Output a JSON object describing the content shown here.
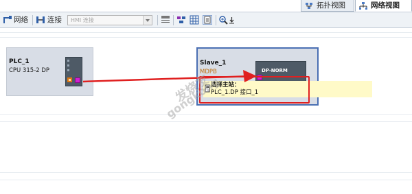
{
  "view_tabs": [
    {
      "label": "拓扑视图",
      "icon": "topology-view-icon",
      "active": false
    },
    {
      "label": "网络视图",
      "icon": "network-view-icon",
      "active": true
    }
  ],
  "toolbar": {
    "network_label": "网络",
    "connections_label": "连接",
    "connection_type_value": "HMI 连接"
  },
  "devices": [
    {
      "name": "PLC_1",
      "type": "CPU 315-2 DP"
    },
    {
      "name": "Slave_1",
      "type": "MDPB",
      "badge": "DP-NORM"
    }
  ],
  "tooltip": {
    "title": "选择主站：",
    "option": "PLC_1.DP 接口_1"
  },
  "watermark": {
    "cn": "发烧友",
    "en": "gongkong"
  },
  "colors": {
    "highlight_red": "#e02020",
    "selection_blue": "#4a6fb3",
    "tooltip_bg": "#fffac8",
    "device_bg": "#d8dde6",
    "port_magenta": "#d020d0",
    "port_orange": "#e07810"
  }
}
